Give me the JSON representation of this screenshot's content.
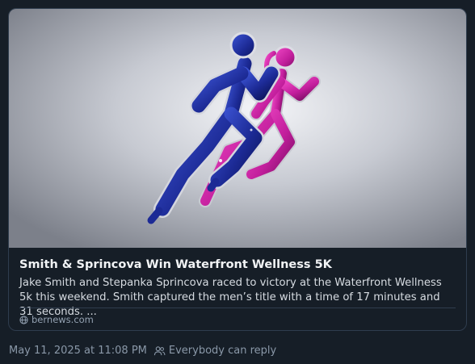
{
  "post": {
    "link_card": {
      "image_alt": "",
      "title": "Smith & Sprincova Win Waterfront Wellness 5K",
      "description": "Jake Smith and Stepanka Sprincova raced to victory at the Waterfront Wellness 5k this weekend. Smith captured the men’s title with a time of 17 minutes and 31 seconds. ...",
      "source": "bernews.com"
    },
    "timestamp": "May 11, 2025 at 11:08 PM",
    "reply_setting": "Everybody can reply"
  },
  "icons": {
    "source": "globe-icon",
    "reply": "people-icon"
  },
  "colors": {
    "background": "#161e27",
    "border": "#2f3d4e",
    "runner_male": "#1f2f9e",
    "runner_female": "#c21e9c"
  }
}
